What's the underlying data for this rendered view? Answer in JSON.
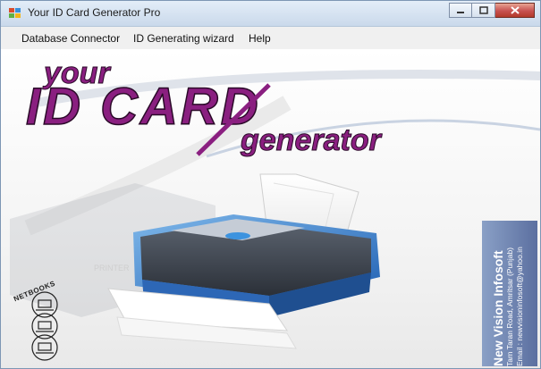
{
  "window": {
    "title": "Your ID Card Generator Pro"
  },
  "menu": {
    "items": [
      {
        "label": "Database Connector"
      },
      {
        "label": "ID Generating wizard"
      },
      {
        "label": "Help"
      }
    ]
  },
  "splash": {
    "logo_line1": "your",
    "logo_line2": "ID CARD",
    "logo_line3": "generator",
    "printer_label": "PRINTER",
    "netbooks_label": "NETBOOKS",
    "company_name": "New Vision Infosoft",
    "company_address": "Tarn Taran Road, Amritsar (Punjab)",
    "company_email": "Email : newvisioninfosoft@yahoo.in"
  },
  "colors": {
    "logo_purple": "#8a1f80",
    "titlebar": "#d6e3f2",
    "panel": "#6f84b3"
  }
}
